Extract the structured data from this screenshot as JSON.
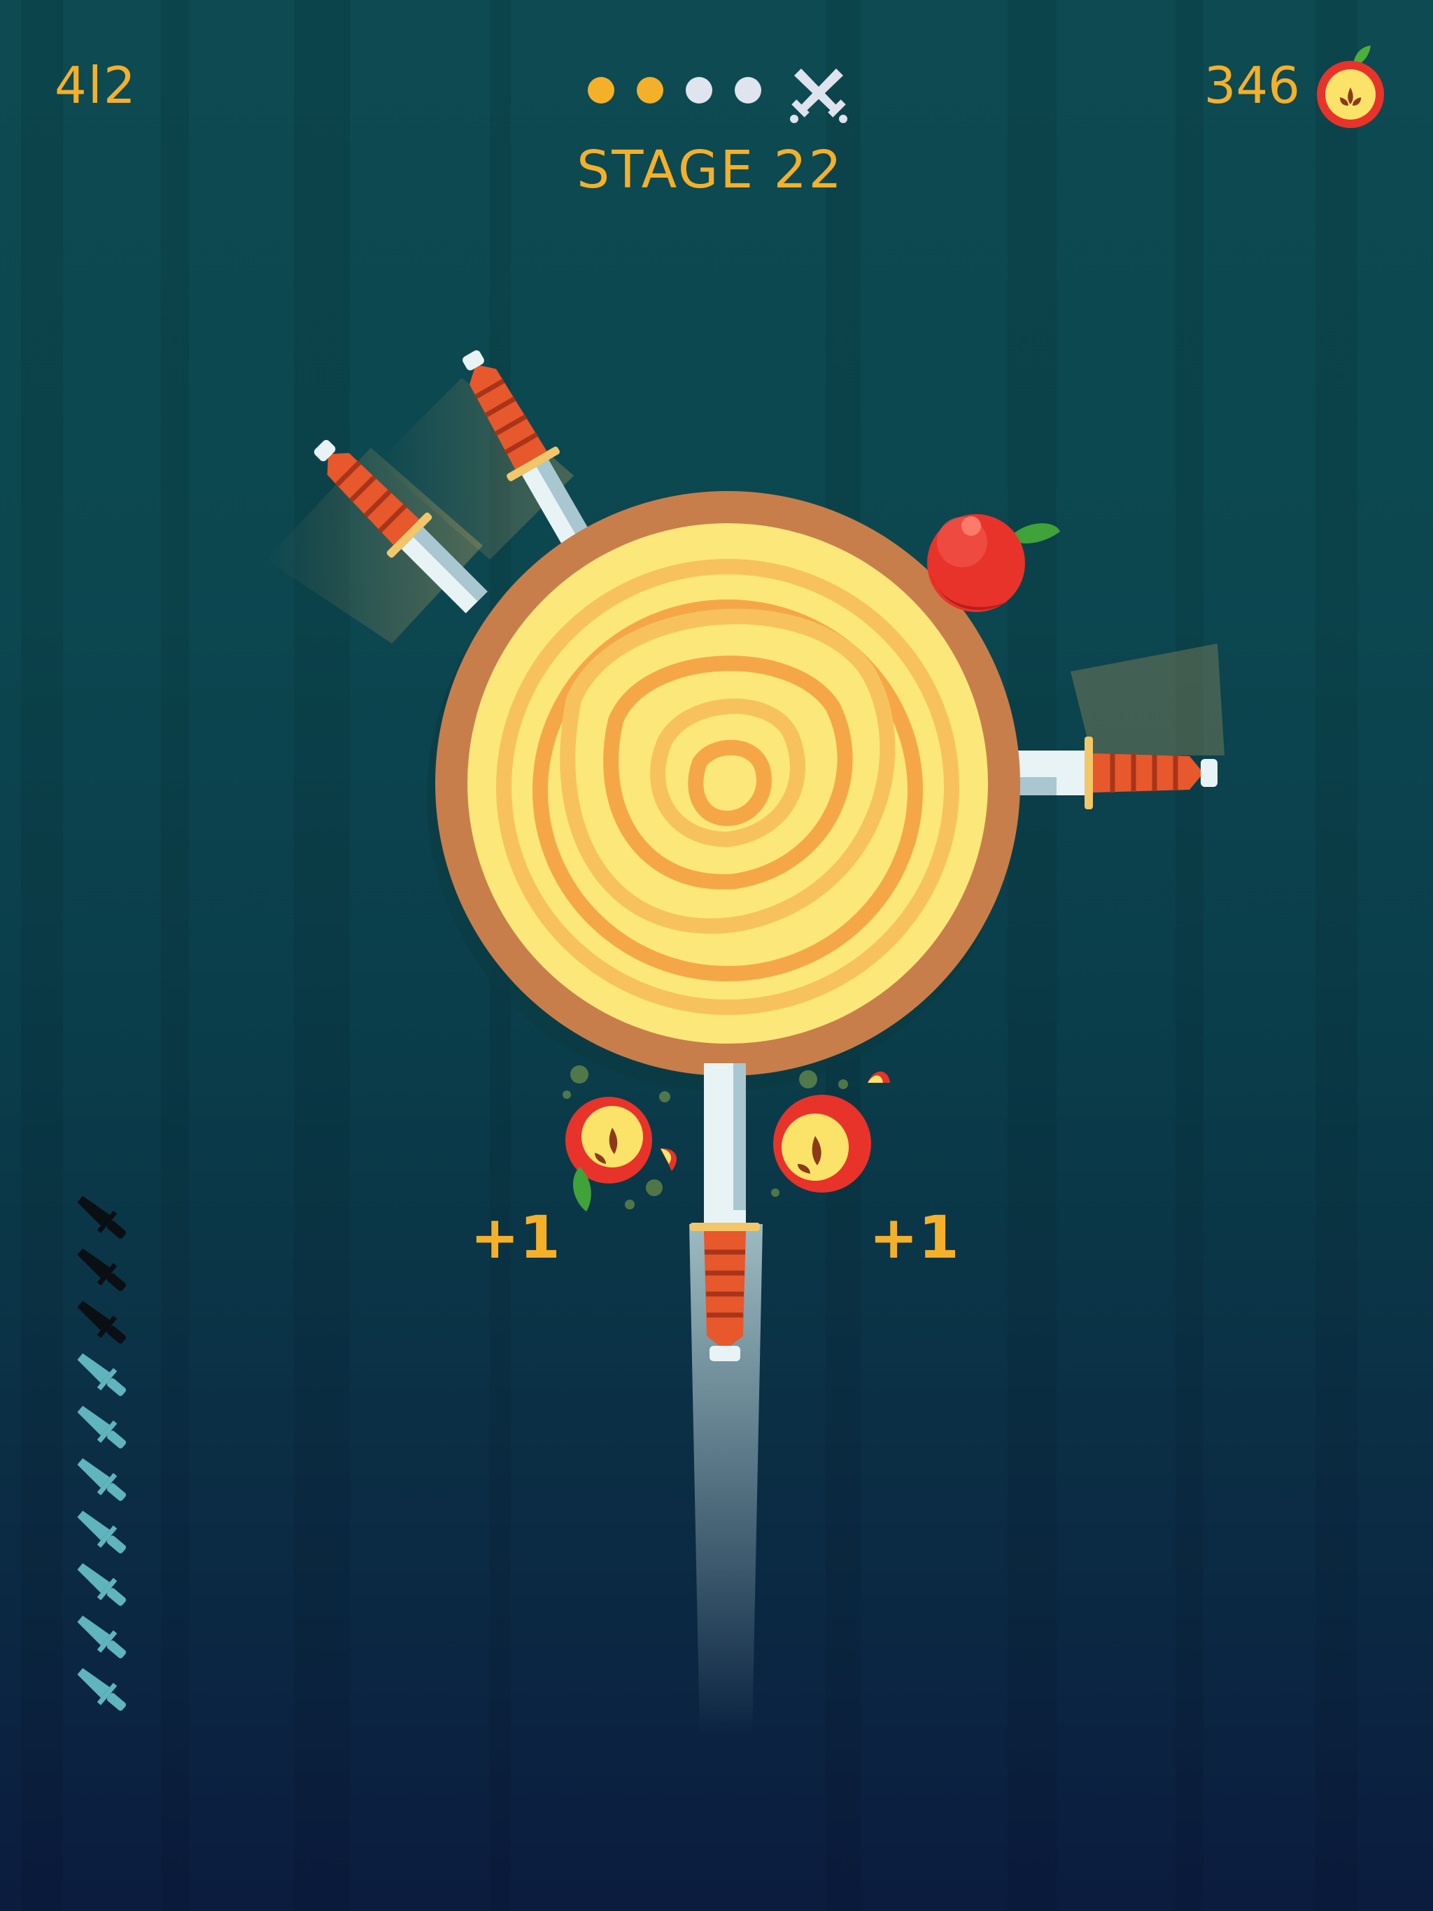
{
  "hud": {
    "score": "4l2",
    "apples": "346",
    "stage_label": "STAGE 22",
    "stage_progress": {
      "completed": 2,
      "total": 4,
      "boss_icon": "crossed-swords-icon"
    },
    "apple_icon": "sliced-apple-icon"
  },
  "popups": {
    "left": "+1",
    "right": "+1"
  },
  "knives_remaining": {
    "used": 3,
    "available": 7,
    "icon": "knife-icon"
  },
  "colors": {
    "accent": "#f5b02a",
    "knife_used": "#0a0f14",
    "knife_available": "#5fb4be",
    "log_rim": "#c87e4a",
    "log_face": "#fbe77a"
  }
}
